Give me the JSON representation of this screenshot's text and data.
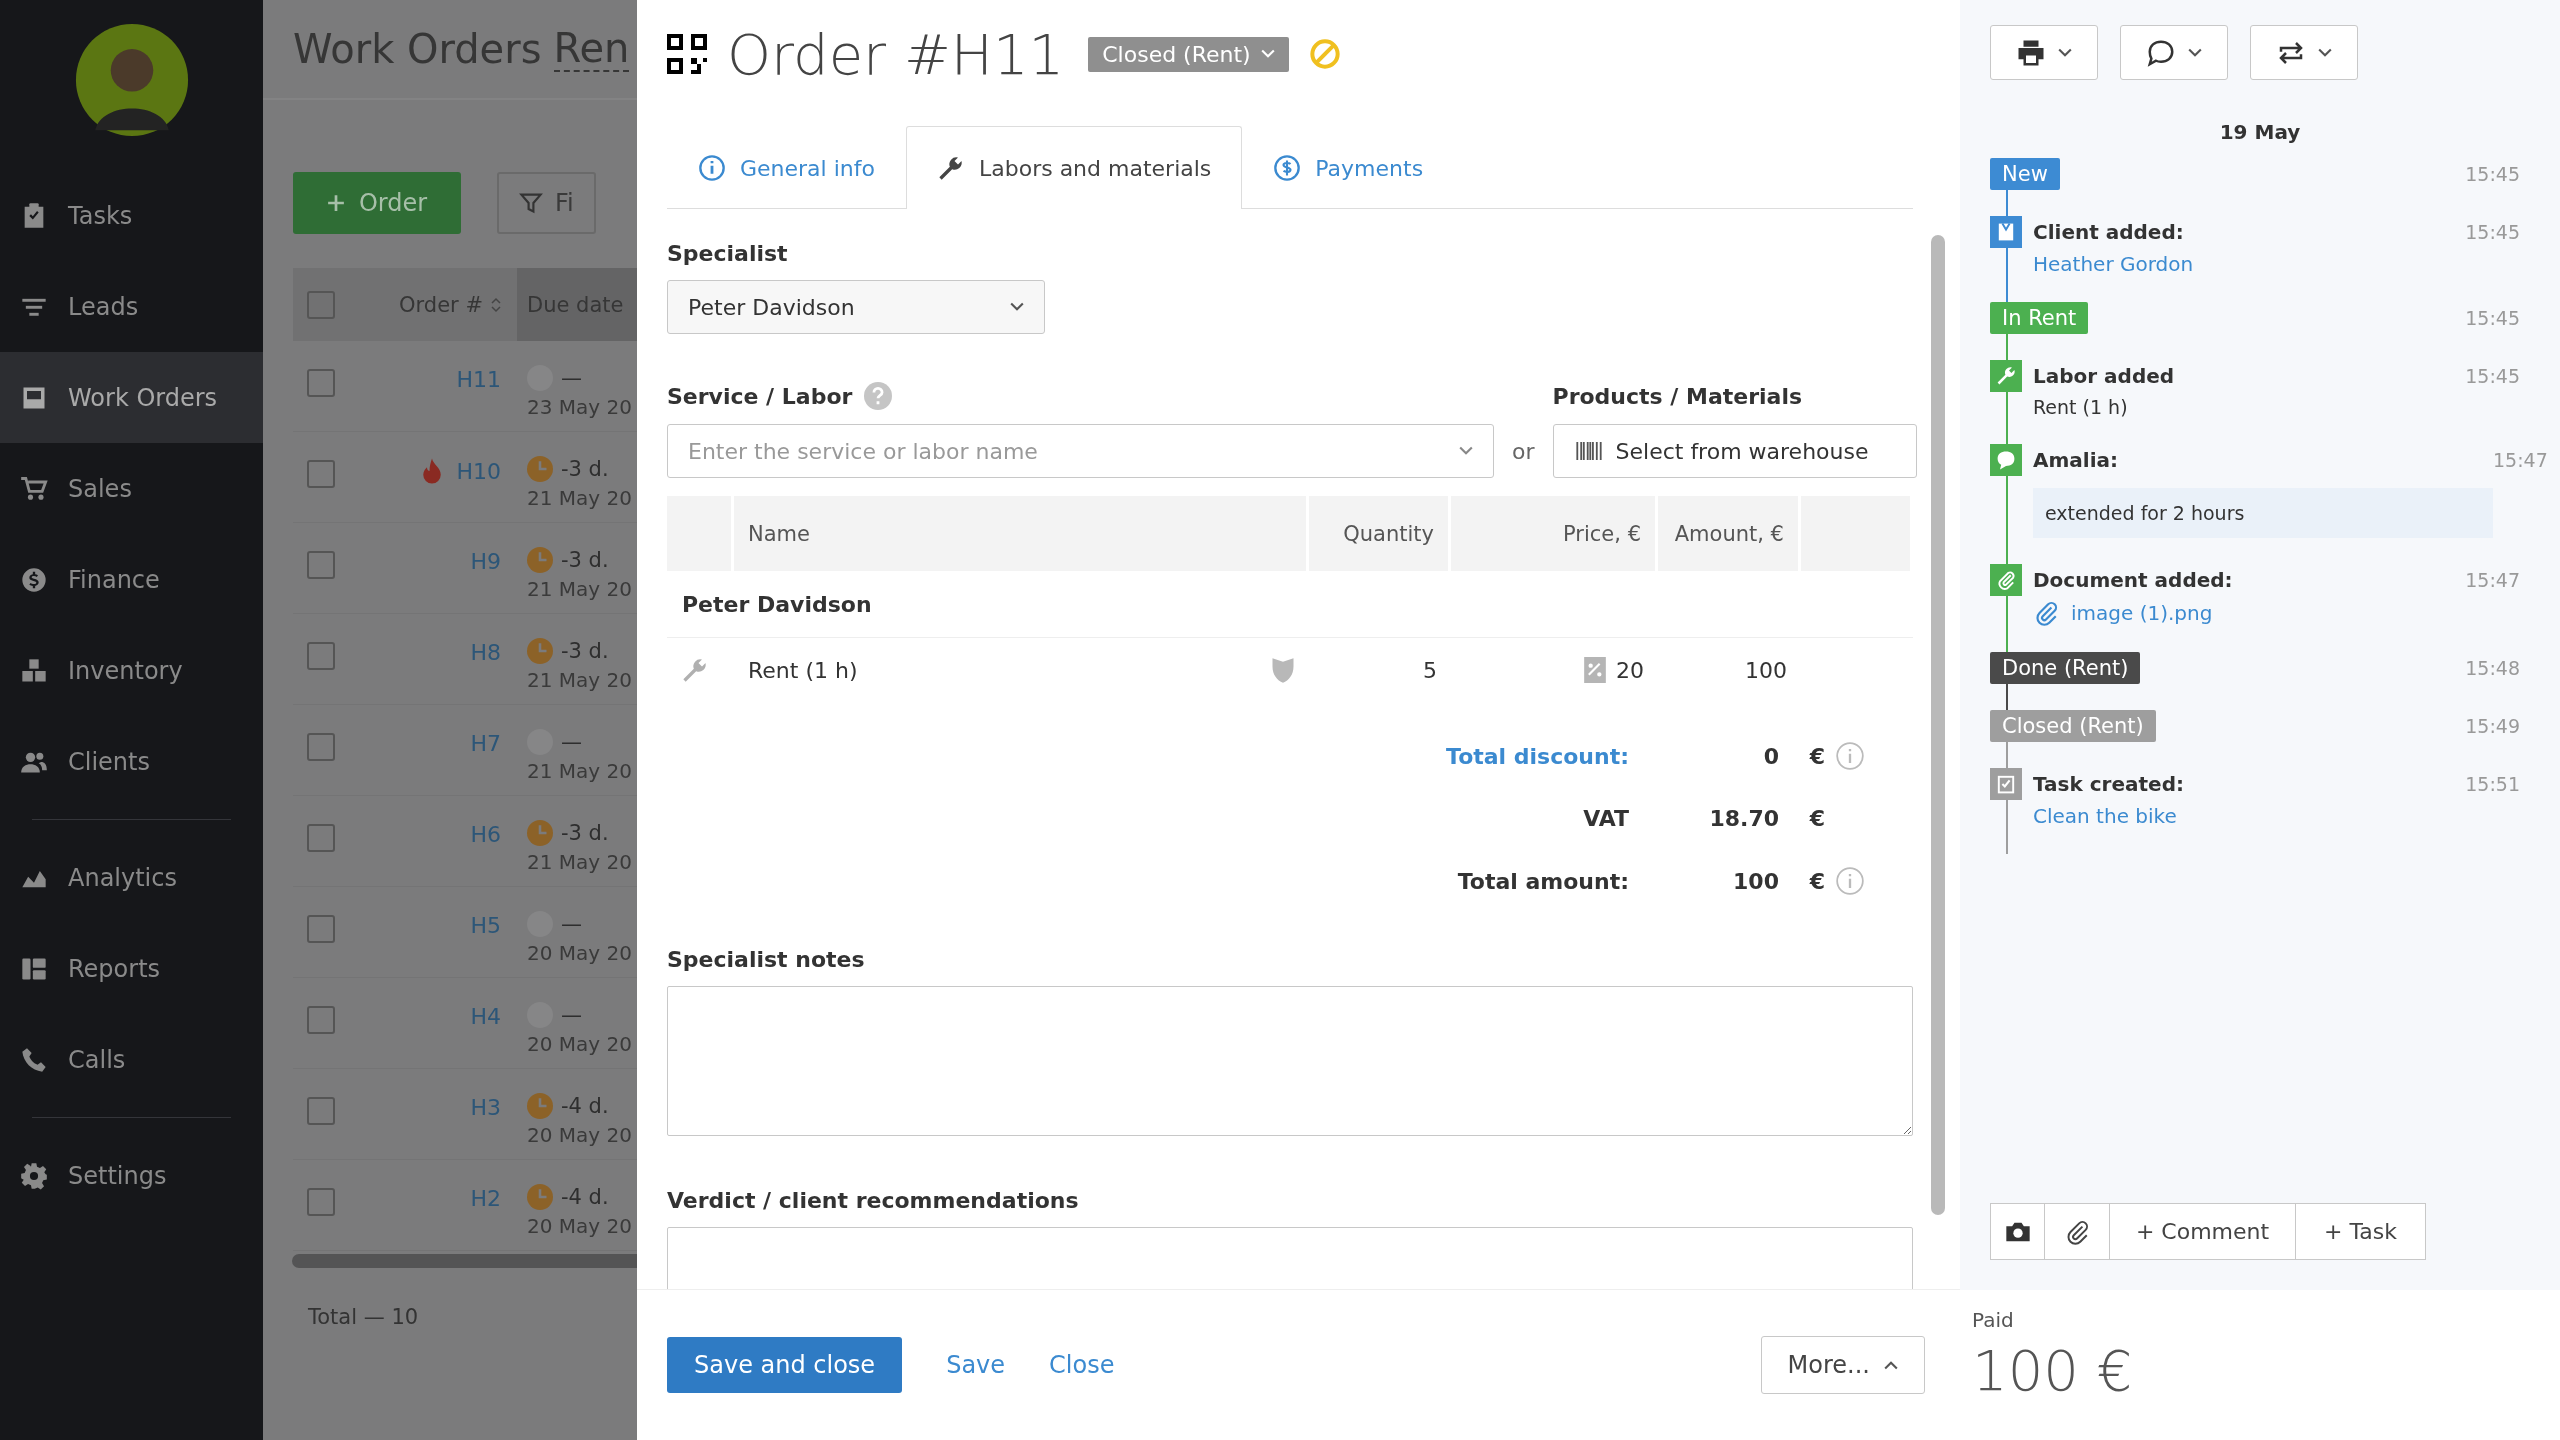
{
  "sidebar": {
    "groups": [
      {
        "items": [
          {
            "label": "Tasks",
            "selected": false
          },
          {
            "label": "Leads",
            "selected": false
          },
          {
            "label": "Work Orders",
            "selected": true
          },
          {
            "label": "Sales",
            "selected": false
          },
          {
            "label": "Finance",
            "selected": false
          },
          {
            "label": "Inventory",
            "selected": false
          },
          {
            "label": "Clients",
            "selected": false
          }
        ]
      },
      {
        "items": [
          {
            "label": "Analytics",
            "selected": false
          },
          {
            "label": "Reports",
            "selected": false
          },
          {
            "label": "Calls",
            "selected": false
          }
        ]
      },
      {
        "items": [
          {
            "label": "Settings",
            "selected": false
          }
        ]
      }
    ]
  },
  "page": {
    "title": "Work Orders",
    "tab": "Ren",
    "add_button": "Order",
    "filter_button": "Fi",
    "select_all": {
      "checked": false
    },
    "columns": [
      "Order #",
      "Due date"
    ],
    "rows": [
      {
        "number": "H11",
        "checked": false,
        "urgent": false,
        "overdue": false,
        "due": "—",
        "date": "23 May 20"
      },
      {
        "number": "H10",
        "checked": false,
        "urgent": true,
        "overdue": true,
        "due": "-3 d.",
        "date": "21 May 20"
      },
      {
        "number": "H9",
        "checked": false,
        "urgent": false,
        "overdue": true,
        "due": "-3 d.",
        "date": "21 May 20"
      },
      {
        "number": "H8",
        "checked": false,
        "urgent": false,
        "overdue": true,
        "due": "-3 d.",
        "date": "21 May 20"
      },
      {
        "number": "H7",
        "checked": false,
        "urgent": false,
        "overdue": false,
        "due": "—",
        "date": "21 May 20"
      },
      {
        "number": "H6",
        "checked": false,
        "urgent": false,
        "overdue": true,
        "due": "-3 d.",
        "date": "21 May 20"
      },
      {
        "number": "H5",
        "checked": false,
        "urgent": false,
        "overdue": false,
        "due": "—",
        "date": "20 May 20"
      },
      {
        "number": "H4",
        "checked": false,
        "urgent": false,
        "overdue": false,
        "due": "—",
        "date": "20 May 20"
      },
      {
        "number": "H3",
        "checked": false,
        "urgent": false,
        "overdue": true,
        "due": "-4 d.",
        "date": "20 May 20"
      },
      {
        "number": "H2",
        "checked": false,
        "urgent": false,
        "overdue": true,
        "due": "-4 d.",
        "date": "20 May 20"
      }
    ],
    "total": "Total — 10"
  },
  "order": {
    "title": "Order #H11",
    "status": "Closed (Rent)",
    "tabs": [
      {
        "label": "General info",
        "selected": false
      },
      {
        "label": "Labors and materials",
        "selected": true
      },
      {
        "label": "Payments",
        "selected": false
      }
    ],
    "specialist": {
      "label": "Specialist",
      "value": "Peter Davidson"
    },
    "service": {
      "label": "Service / Labor",
      "placeholder": "Enter the service or labor name"
    },
    "or": "or",
    "products": {
      "label": "Products / Materials",
      "button": "Select from warehouse"
    },
    "table": {
      "columns": [
        "Name",
        "Quantity",
        "Price, €",
        "Amount, €"
      ],
      "groups": [
        {
          "name": "Peter Davidson",
          "rows": [
            {
              "name": "Rent (1 h)",
              "quantity": "5",
              "price": "20",
              "amount": "100"
            }
          ]
        }
      ]
    },
    "totals": [
      {
        "kind": "link",
        "label": "Total discount:",
        "value": "0",
        "currency": "€",
        "info": true
      },
      {
        "kind": "plain",
        "label": "VAT",
        "value": "18.70",
        "currency": "€",
        "info": false
      },
      {
        "kind": "plain",
        "label": "Total amount:",
        "value": "100",
        "currency": "€",
        "info": true
      }
    ],
    "notes": {
      "label": "Specialist notes"
    },
    "verdict": {
      "label": "Verdict / client recommendations"
    },
    "footer": {
      "primary": "Save and close",
      "links": [
        "Save",
        "Close"
      ],
      "more": "More..."
    }
  },
  "activity": {
    "date": "19 May",
    "events": [
      {
        "kind": "status",
        "title": "New",
        "time": "15:45",
        "color": "#3d8bd3"
      },
      {
        "kind": "client",
        "title": "Client added:",
        "time": "15:45",
        "color": "#3d8bd3",
        "link": "Heather Gordon"
      },
      {
        "kind": "status",
        "title": "In Rent",
        "time": "15:45",
        "color": "#4cb050"
      },
      {
        "kind": "labor",
        "title": "Labor added",
        "time": "15:45",
        "color": "#4cb050",
        "note": "Rent (1 h)"
      },
      {
        "kind": "comment",
        "title": "Amalia:",
        "time": "15:47",
        "color": "#4cb050",
        "comment": "extended for 2 hours"
      },
      {
        "kind": "document",
        "title": "Document added:",
        "time": "15:47",
        "color": "#4cb050",
        "file": "image (1).png"
      },
      {
        "kind": "status",
        "title": "Done (Rent)",
        "time": "15:48",
        "color": "#4a4a4a"
      },
      {
        "kind": "status",
        "title": "Closed (Rent)",
        "time": "15:49",
        "color": "#9e9e9e"
      },
      {
        "kind": "task",
        "title": "Task created:",
        "time": "15:51",
        "color": "#9e9e9e",
        "link": "Clean the bike"
      }
    ],
    "actions": [
      "+ Comment",
      "+ Task"
    ],
    "paid": {
      "label": "Paid",
      "amount": "100 €"
    }
  }
}
